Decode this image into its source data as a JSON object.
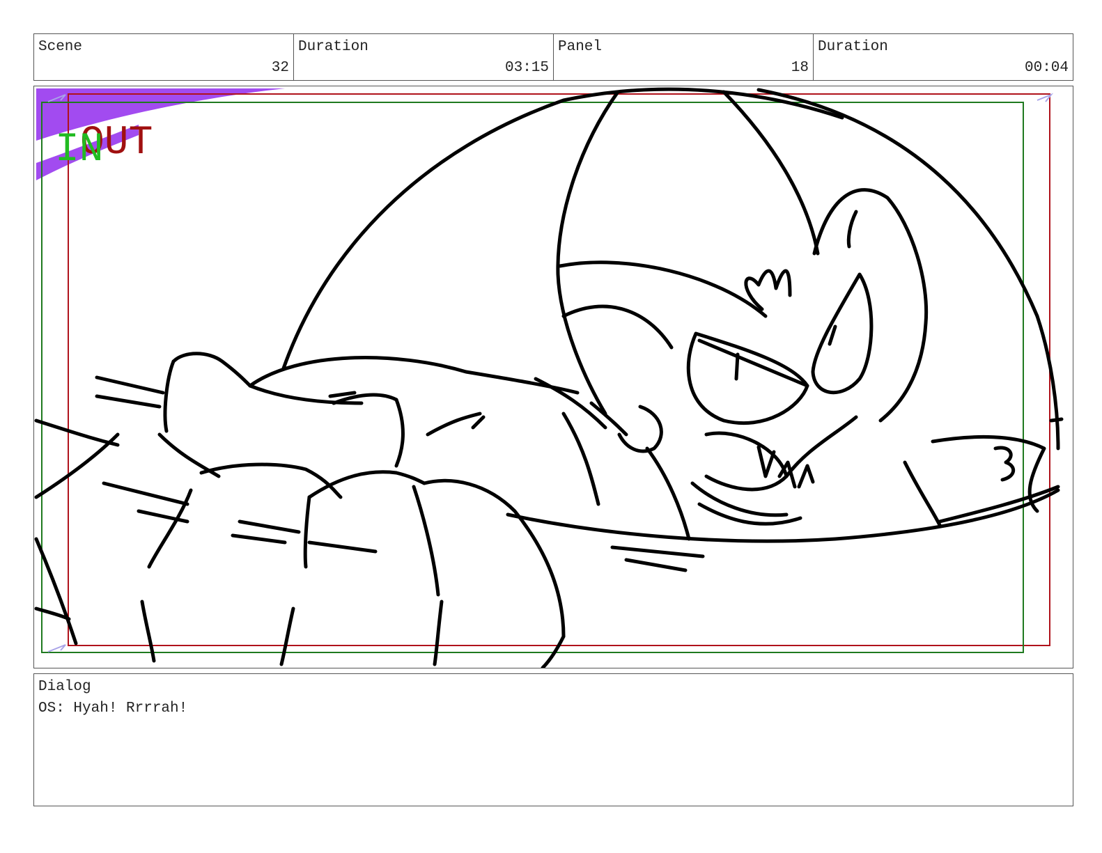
{
  "header": {
    "scene_label": "Scene",
    "scene_value": "32",
    "scene_duration_label": "Duration",
    "scene_duration_value": "03:15",
    "panel_label": "Panel",
    "panel_value": "18",
    "panel_duration_label": "Duration",
    "panel_duration_value": "00:04"
  },
  "panel": {
    "in_marker": "IN",
    "out_marker": "OUT",
    "colors": {
      "in_frame": "#1f7a1f",
      "out_frame": "#b0121b",
      "in_text": "#22bb22",
      "out_text": "#a01010",
      "corner_fill": "#a24bf0",
      "ink": "#000000"
    }
  },
  "dialog": {
    "label": "Dialog",
    "text": "OS: Hyah! Rrrrah!"
  }
}
